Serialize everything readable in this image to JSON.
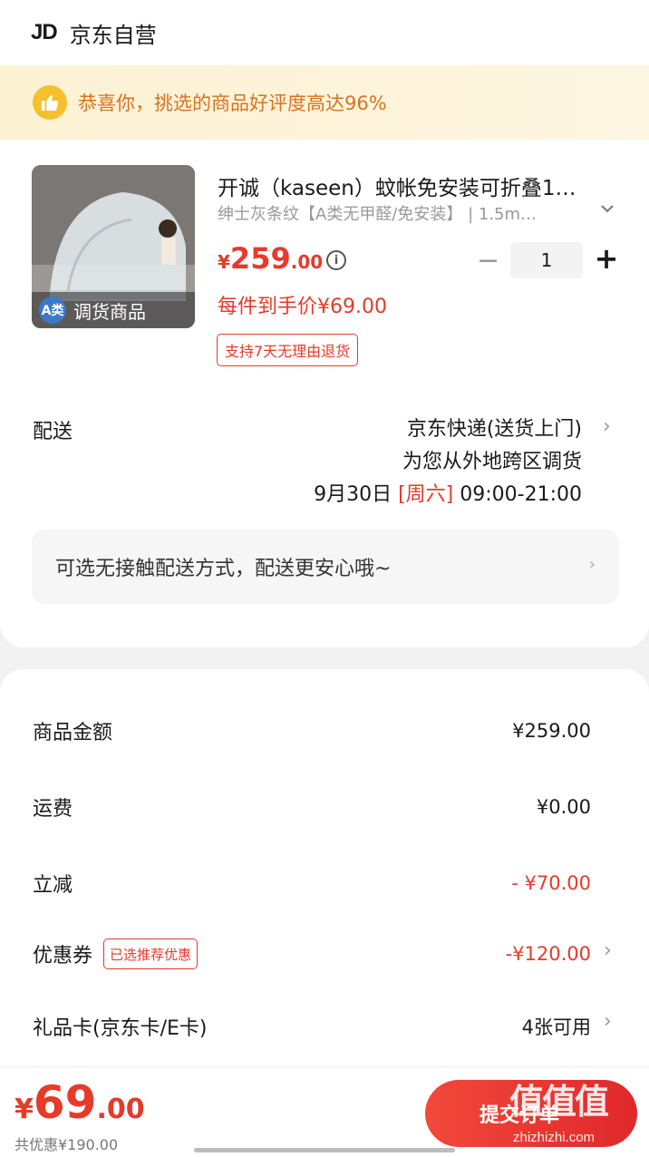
{
  "header": {
    "logo": "JD",
    "store": "京东自营"
  },
  "banner": {
    "text": "恭喜你，挑选的商品好评度高达96%",
    "icon": "thumbs-up-icon"
  },
  "product": {
    "image_tag_badge": "A类",
    "image_tag": "调货商品",
    "title": "开诚（kaseen）蚊帐免安装可折叠1…",
    "spec": "绅士灰条纹【A类无甲醛/免安装】 | 1.5m…",
    "price_yen": "¥",
    "price_int": "259",
    "price_dec": ".00",
    "quantity": "1",
    "unit_price": "每件到手价¥69.00",
    "return_policy": "支持7天无理由退货"
  },
  "shipping": {
    "label": "配送",
    "method": "京东快递(送货上门)",
    "note": "为您从外地跨区调货",
    "date": "9月30日",
    "weekday": "[周六]",
    "time": "09:00-21:00"
  },
  "contactless": {
    "text": "可选无接触配送方式，配送更安心哦~"
  },
  "summary": {
    "goods_label": "商品金额",
    "goods_value": "¥259.00",
    "freight_label": "运费",
    "freight_value": "¥0.00",
    "discount_label": "立减",
    "discount_value": "- ¥70.00",
    "coupon_label": "优惠券",
    "coupon_badge": "已选推荐优惠",
    "coupon_value": "-¥120.00",
    "giftcard_label": "礼品卡(京东卡/E卡)",
    "giftcard_value": "4张可用"
  },
  "footer": {
    "total_yen": "¥",
    "total_int": "69",
    "total_dec": ".00",
    "saved": "共优惠¥190.00",
    "submit_label": "提交订单",
    "watermark_chars": "值值值",
    "watermark_url": "zhizhizhi.com"
  },
  "colors": {
    "accent": "#e63a2b",
    "banner_text": "#d9731f",
    "banner_bg": "#fdf1d3"
  }
}
